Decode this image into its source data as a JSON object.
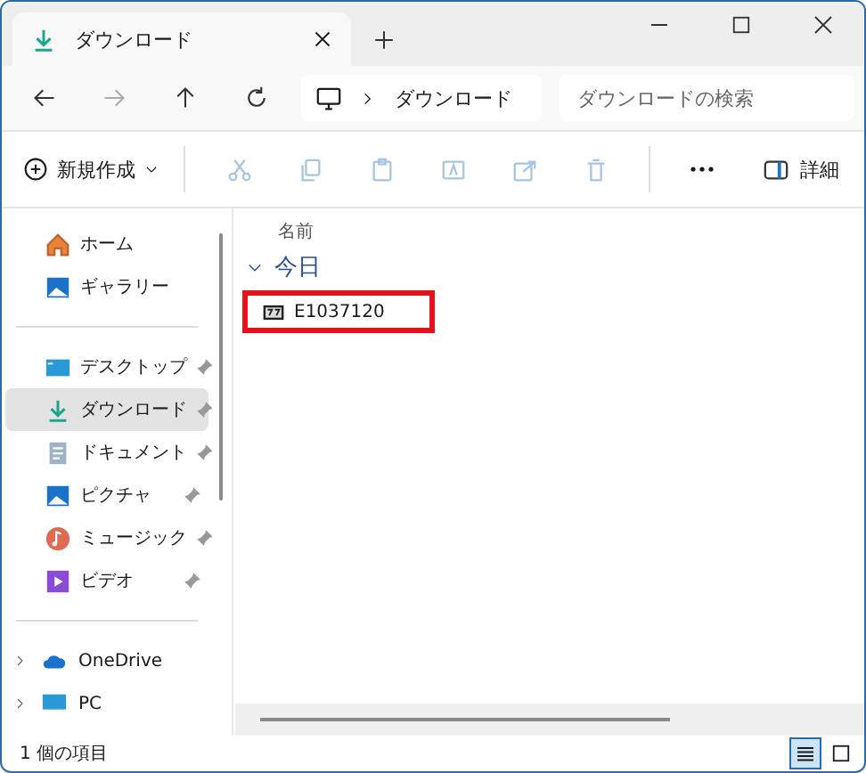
{
  "tab": {
    "title": "ダウンロード",
    "selected": true
  },
  "address": {
    "path": [
      "ダウンロード"
    ]
  },
  "search": {
    "placeholder": "ダウンロードの検索"
  },
  "toolbar": {
    "new_label": "新規作成",
    "details_label": "詳細"
  },
  "sidebar": {
    "quick": [
      {
        "label": "ホーム",
        "selected": false
      },
      {
        "label": "ギャラリー",
        "selected": false
      }
    ],
    "pinned": [
      {
        "label": "デスクトップ",
        "selected": false,
        "pinned": true
      },
      {
        "label": "ダウンロード",
        "selected": true,
        "pinned": true
      },
      {
        "label": "ドキュメント",
        "selected": false,
        "pinned": true
      },
      {
        "label": "ピクチャ",
        "selected": false,
        "pinned": true
      },
      {
        "label": "ミュージック",
        "selected": false,
        "pinned": true
      },
      {
        "label": "ビデオ",
        "selected": false,
        "pinned": true
      }
    ],
    "tree": [
      {
        "label": "OneDrive",
        "expanded": false
      },
      {
        "label": "PC",
        "expanded": false
      }
    ]
  },
  "content": {
    "column": "名前",
    "group": {
      "label": "今日",
      "expanded": true
    },
    "files": [
      {
        "name": "E1037120",
        "highlighted": true
      }
    ]
  },
  "status_bar": {
    "text": "1 個の項目",
    "views": [
      {
        "selected": true
      },
      {
        "selected": false
      }
    ]
  }
}
